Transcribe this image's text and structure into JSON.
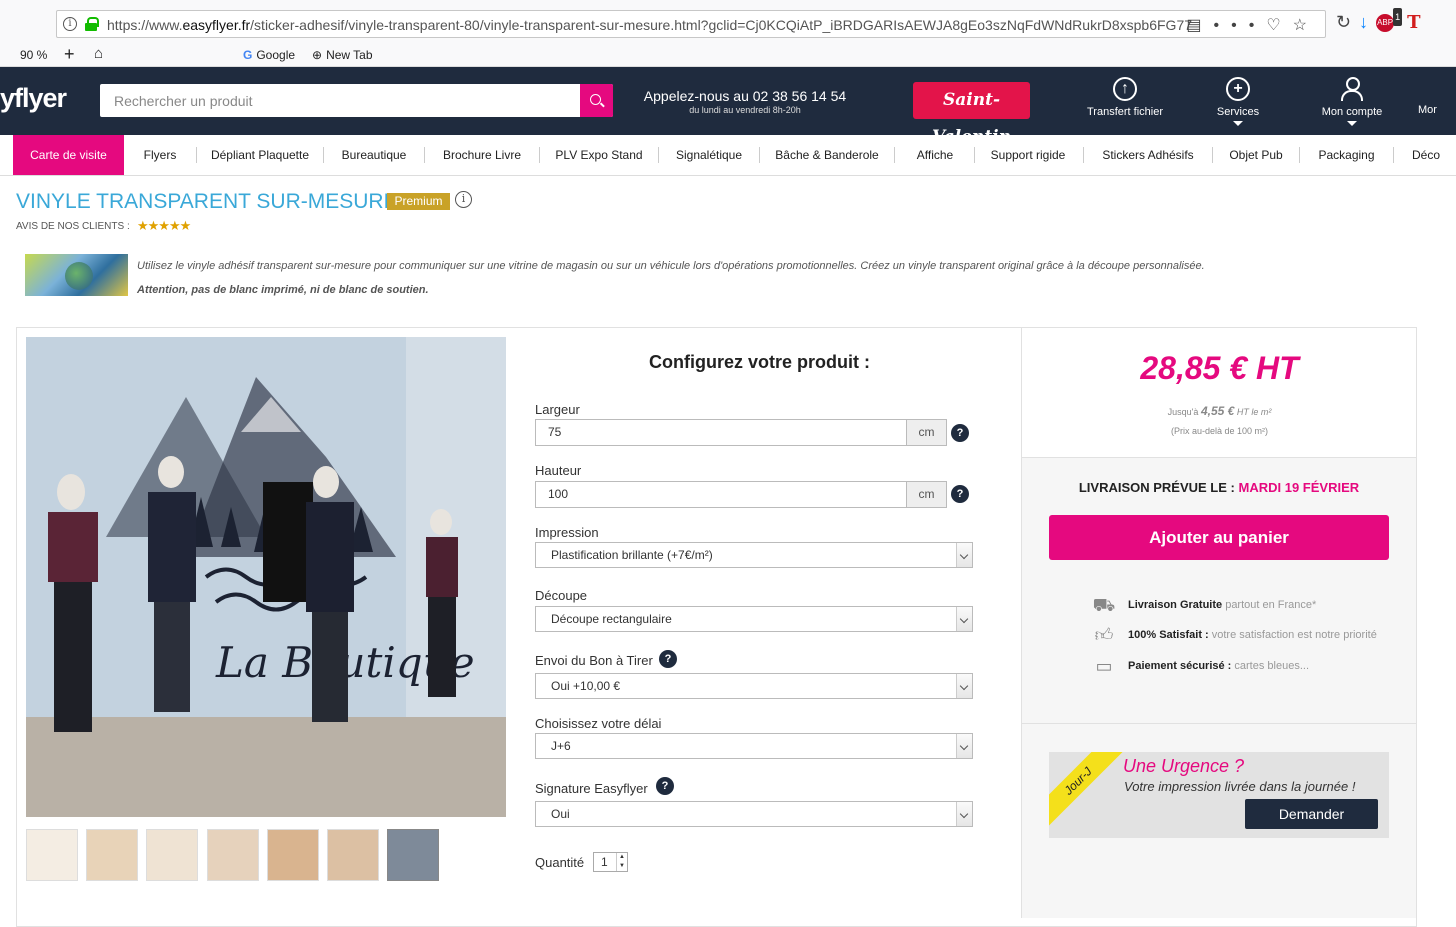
{
  "browser": {
    "url_prefix": "https://www.",
    "url_domain": "easyflyer.fr",
    "url_rest": "/sticker-adhesif/vinyle-transparent-80/vinyle-transparent-sur-mesure.html?gclid=Cj0KCQiAtP_iBRDGARIsAEWJA8gEo3szNqFdWNdRukrD8xspb6FG77",
    "zoom": "90 %",
    "bookmarks": [
      "Google",
      "New Tab"
    ],
    "adblock_count": "1"
  },
  "header": {
    "logo": "yflyer",
    "search_placeholder": "Rechercher un produit",
    "phone_line1": "Appelez-nous au 02 38 56 14 54",
    "phone_line2": "du lundi au vendredi 8h-20h",
    "promo": "Saint-Valentin",
    "transfer": "Transfert fichier",
    "services": "Services",
    "account": "Mon compte",
    "more": "Mor"
  },
  "nav": [
    "Carte de visite",
    "Flyers",
    "Dépliant Plaquette",
    "Bureautique",
    "Brochure Livre",
    "PLV Expo Stand",
    "Signalétique",
    "Bâche & Banderole",
    "Affiche",
    "Support rigide",
    "Stickers Adhésifs",
    "Objet Pub",
    "Packaging",
    "Déco"
  ],
  "product": {
    "title": "VINYLE TRANSPARENT SUR-MESURE",
    "badge": "Premium",
    "reviews_label": "AVIS DE NOS CLIENTS :",
    "rating": "★★★★★",
    "desc1": "Utilisez le vinyle adhésif transparent sur-mesure pour communiquer sur une vitrine de magasin ou sur un véhicule lors d'opérations promotionnelles. Créez un vinyle transparent original grâce à la découpe personnalisée.",
    "desc2": "Attention, pas de blanc imprimé, ni de blanc de soutien.",
    "photo_text": "La Boutique"
  },
  "config": {
    "title": "Configurez votre produit :",
    "largeur_label": "Largeur",
    "largeur_value": "75",
    "hauteur_label": "Hauteur",
    "hauteur_value": "100",
    "unit": "cm",
    "impression_label": "Impression",
    "impression_value": "Plastification brillante (+7€/m²)",
    "decoupe_label": "Découpe",
    "decoupe_value": "Découpe rectangulaire",
    "bat_label": "Envoi du Bon à Tirer",
    "bat_value": "Oui +10,00 €",
    "delai_label": "Choisissez votre délai",
    "delai_value": "J+6",
    "signature_label": "Signature Easyflyer",
    "signature_value": "Oui",
    "qty_label": "Quantité",
    "qty_value": "1"
  },
  "price": {
    "main": "28,85 € HT",
    "sub_prefix": "Jusqu'à",
    "sub_value": "4,55 €",
    "sub_suffix": "HT le m²",
    "sub2": "(Prix au-delà de 100 m²)",
    "delivery_label": "LIVRAISON PRÉVUE LE :",
    "delivery_date": "MARDI 19 FÉVRIER",
    "cart_button": "Ajouter au panier"
  },
  "features": [
    {
      "bold": "Livraison Gratuite",
      "text": " partout en France*",
      "icon": "truck-icon"
    },
    {
      "bold": "100% Satisfait :",
      "text": " votre satisfaction est notre priorité",
      "icon": "thumbs-up-icon"
    },
    {
      "bold": "Paiement sécurisé :",
      "text": " cartes bleues...",
      "icon": "secure-card-icon"
    }
  ],
  "urgence": {
    "band": "Jour-J",
    "title": "Une Urgence ?",
    "subtitle": "Votre impression livrée dans la journée !",
    "button": "Demander"
  },
  "colors": {
    "accent": "#e5097f",
    "header_bg": "#1f2b3e",
    "title_blue": "#3aa8d8",
    "premium_gold": "#c9a227"
  }
}
